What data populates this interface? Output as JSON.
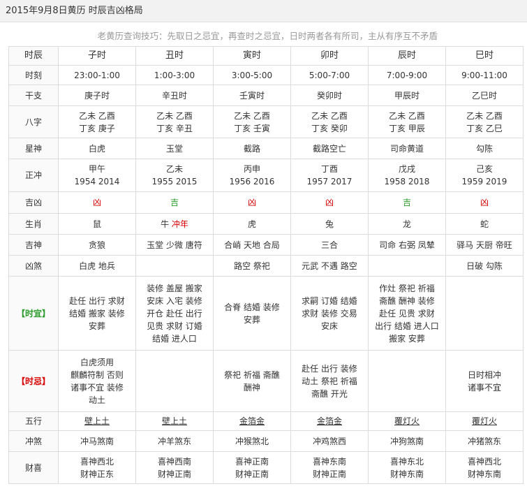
{
  "title": "2015年9月8日黄历 时辰吉凶格局",
  "tip": "老黄历查询技巧：先取日之忌宜，再查时之忌宜，日时两者各有所司，主从有序互不矛盾",
  "row_labels": {
    "shichen": "时辰",
    "shike": "时刻",
    "ganzhi": "干支",
    "bazi": "八字",
    "xingshen": "星神",
    "zhengchong": "正冲",
    "jixiong": "吉凶",
    "shengxiao": "生肖",
    "jishen": "吉神",
    "xiongsha": "凶煞",
    "shiyi": "【时宜】",
    "shiji": "【时忌】",
    "wuxing": "五行",
    "chongsha": "冲煞",
    "caixi": "财喜"
  },
  "columns": [
    {
      "name": "子时",
      "time": "23:00-1:00",
      "ganzhi": "庚子时",
      "bazi1": "乙未 乙酉",
      "bazi2": "丁亥 庚子",
      "xingshen": "白虎",
      "chong1": "甲午",
      "chong2": "1954 2014",
      "jixiong": "凶",
      "shengxiao": "鼠",
      "shengxiao_extra": "",
      "jishen": "贪狼",
      "xiongsha": "白虎 地兵",
      "yi": [
        "赴任 出行 求财",
        "结婚 搬家 装修",
        "安葬"
      ],
      "ji": [
        "白虎须用",
        "麒麟符制 否则",
        "诸事不宜 装修",
        "动土"
      ],
      "wuxing": "壁上土",
      "chongsha": "冲马煞南",
      "caixi1": "喜神西北",
      "caixi2": "财神正东"
    },
    {
      "name": "丑时",
      "time": "1:00-3:00",
      "ganzhi": "辛丑时",
      "bazi1": "乙未 乙酉",
      "bazi2": "丁亥 辛丑",
      "xingshen": "玉堂",
      "chong1": "乙未",
      "chong2": "1955 2015",
      "jixiong": "吉",
      "shengxiao": "牛",
      "shengxiao_extra": "冲年",
      "jishen": "玉堂 少微 唐符",
      "xiongsha": "",
      "yi": [
        "装修 盖屋 搬家",
        "安床 入宅 装修",
        "开仓 赴任 出行",
        "见贵 求财 订婚",
        "结婚 进人口"
      ],
      "ji": [],
      "wuxing": "壁上土",
      "chongsha": "冲羊煞东",
      "caixi1": "喜神西南",
      "caixi2": "财神正南"
    },
    {
      "name": "寅时",
      "time": "3:00-5:00",
      "ganzhi": "壬寅时",
      "bazi1": "乙未 乙酉",
      "bazi2": "丁亥 壬寅",
      "xingshen": "截路",
      "chong1": "丙申",
      "chong2": "1956 2016",
      "jixiong": "凶",
      "shengxiao": "虎",
      "shengxiao_extra": "",
      "jishen": "合峭 天地 合局",
      "xiongsha": "路空 祭祀",
      "yi": [
        "合脊 结婚 装修",
        "安葬"
      ],
      "ji": [
        "祭祀 祈福 斋醮",
        "酬神"
      ],
      "wuxing": "金箔金",
      "chongsha": "冲猴煞北",
      "caixi1": "喜神正南",
      "caixi2": "财神正南"
    },
    {
      "name": "卯时",
      "time": "5:00-7:00",
      "ganzhi": "癸卯时",
      "bazi1": "乙未 乙酉",
      "bazi2": "丁亥 癸卯",
      "xingshen": "截路空亡",
      "chong1": "丁酉",
      "chong2": "1957 2017",
      "jixiong": "凶",
      "shengxiao": "兔",
      "shengxiao_extra": "",
      "jishen": "三合",
      "xiongsha": "元武 不遇 路空",
      "yi": [
        "求嗣 订婚 结婚",
        "求财 装修 交易",
        "安床"
      ],
      "ji": [
        "赴任 出行 装修",
        "动土 祭祀 祈福",
        "斋醮 开光"
      ],
      "wuxing": "金箔金",
      "chongsha": "冲鸡煞西",
      "caixi1": "喜神东南",
      "caixi2": "财神正南"
    },
    {
      "name": "辰时",
      "time": "7:00-9:00",
      "ganzhi": "甲辰时",
      "bazi1": "乙未 乙酉",
      "bazi2": "丁亥 甲辰",
      "xingshen": "司命黄道",
      "chong1": "戊戌",
      "chong2": "1958 2018",
      "jixiong": "吉",
      "shengxiao": "龙",
      "shengxiao_extra": "",
      "jishen": "司命 右弼 凤辇",
      "xiongsha": "",
      "yi": [
        "作灶 祭祀 祈福",
        "斋醮 酬神 装修",
        "赴任 见贵 求财",
        "出行 结婚 进人口",
        "搬家 安葬"
      ],
      "ji": [],
      "wuxing": "覆灯火",
      "chongsha": "冲狗煞南",
      "caixi1": "喜神东北",
      "caixi2": "财神东南"
    },
    {
      "name": "巳时",
      "time": "9:00-11:00",
      "ganzhi": "乙巳时",
      "bazi1": "乙未 乙酉",
      "bazi2": "丁亥 乙巳",
      "xingshen": "勾陈",
      "chong1": "己亥",
      "chong2": "1959 2019",
      "jixiong": "凶",
      "shengxiao": "蛇",
      "shengxiao_extra": "",
      "jishen": "驿马 天厨 帝旺",
      "xiongsha": "日破 勾陈",
      "yi": [],
      "ji": [
        "日时相冲",
        "诸事不宜"
      ],
      "wuxing": "覆灯火",
      "chongsha": "冲猪煞东",
      "caixi1": "喜神西北",
      "caixi2": "财神东南"
    }
  ],
  "colors": {
    "good": "#2a9b2a",
    "bad": "#d80000"
  }
}
